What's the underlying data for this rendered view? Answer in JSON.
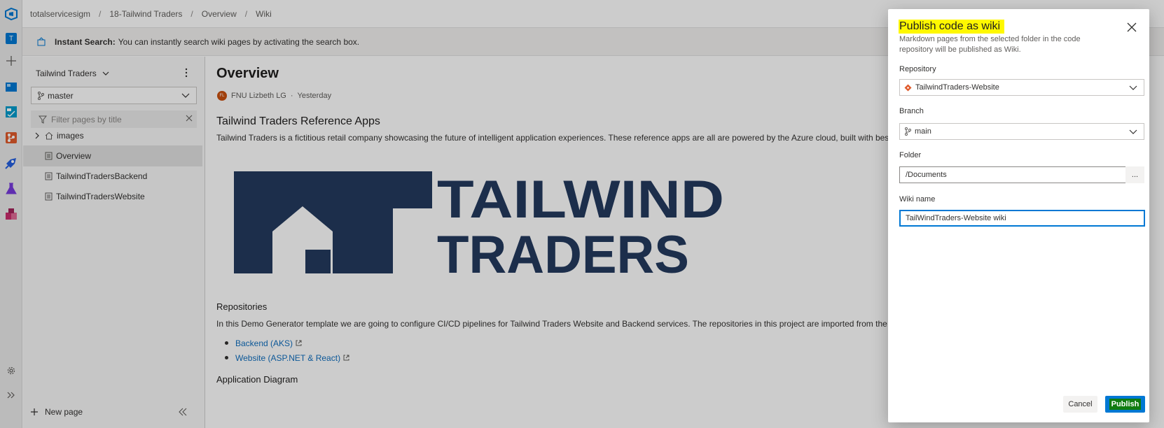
{
  "breadcrumb": [
    "totalservicesigm",
    "18-Tailwind Traders",
    "Overview",
    "Wiki"
  ],
  "rail": {
    "project_initial": "T",
    "icons": [
      "azure-devops-logo-icon",
      "project-avatar-icon",
      "plus-icon",
      "boards-icon",
      "overview-icon",
      "repos-icon",
      "pipelines-icon",
      "test-plans-icon",
      "artifacts-icon",
      "settings-icon",
      "expand-icon"
    ]
  },
  "infobar": {
    "title": "Instant Search:",
    "text": "You can instantly search wiki pages by activating the search box."
  },
  "tree": {
    "wiki_name": "Tailwind Traders",
    "branch": "master",
    "filter_placeholder": "Filter pages by title",
    "items": [
      {
        "label": "images",
        "type": "folder"
      },
      {
        "label": "Overview",
        "type": "page",
        "selected": true
      },
      {
        "label": "TailwindTradersBackend",
        "type": "page"
      },
      {
        "label": "TailwindTradersWebsite",
        "type": "page"
      }
    ],
    "new_page": "New page"
  },
  "main": {
    "title": "Overview",
    "author": "FNU Lizbeth LG",
    "author_initials": "FL",
    "date": "Yesterday",
    "h_reference": "Tailwind Traders Reference Apps",
    "p_reference": "Tailwind Traders is a fictitious retail company showcasing the future of intelligent application experiences. These reference apps are all are powered by the Azure cloud, built with best",
    "logo_line1": "TAILWIND",
    "logo_line2": "TRADERS",
    "h_repos": "Repositories",
    "p_repos": "In this Demo Generator template we are going to configure CI/CD pipelines for Tailwind Traders Website and Backend services. The repositories in this project are imported from the I",
    "links": [
      "Backend (AKS)",
      "Website (ASP.NET & React)"
    ],
    "h_diagram": "Application Diagram"
  },
  "panel": {
    "title": "Publish code as wiki",
    "description": "Markdown pages from the selected folder in the code repository will be published as Wiki.",
    "repository_label": "Repository",
    "repository_value": "TailwindTraders-Website",
    "branch_label": "Branch",
    "branch_value": "main",
    "folder_label": "Folder",
    "folder_value": "/Documents",
    "browse_label": "...",
    "wikiname_label": "Wiki name",
    "wikiname_value": "TailWindTraders-Website wiki",
    "cancel_label": "Cancel",
    "publish_label": "Publish"
  },
  "colors": {
    "accent": "#0078d4",
    "highlight": "#fff800",
    "publish_highlight": "#107c10",
    "logo": "#243a5e",
    "link": "#106ebe"
  }
}
